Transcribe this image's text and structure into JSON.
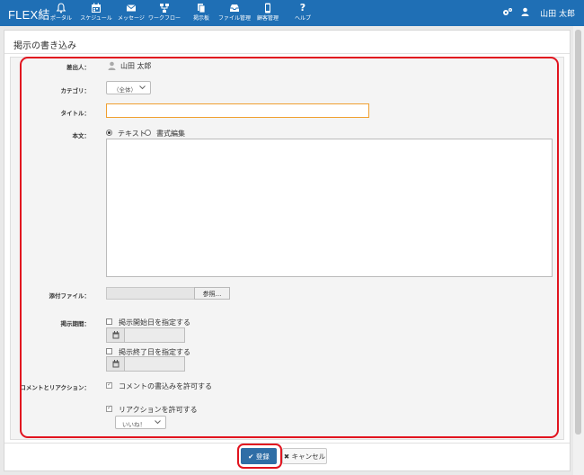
{
  "app": {
    "brand": "FLEX結"
  },
  "nav": [
    {
      "label": "ポータル",
      "icon": "bell-icon"
    },
    {
      "label": "スケジュール",
      "icon": "calendar-icon"
    },
    {
      "label": "メッセージ",
      "icon": "envelope-icon"
    },
    {
      "label": "ワークフロー",
      "icon": "workflow-icon"
    },
    {
      "label": "掲示板",
      "icon": "board-icon"
    },
    {
      "label": "ファイル管理",
      "icon": "inbox-icon"
    },
    {
      "label": "顧客管理",
      "icon": "phone-icon"
    },
    {
      "label": "ヘルプ",
      "icon": "question-icon"
    }
  ],
  "user": {
    "name": "山田 太郎"
  },
  "page": {
    "title": "掲示の書き込み"
  },
  "form": {
    "sender_label": "差出人：",
    "sender_value": "山田 太郎",
    "category_label": "カテゴリ：",
    "category_value": "（全体）",
    "title_label": "タイトル：",
    "title_value": "",
    "body_label": "本文：",
    "body_mode_text": "テキスト",
    "body_mode_rich": "書式編集",
    "body_value": "",
    "attach_label": "添付ファイル：",
    "browse_label": "参照...",
    "period_label": "掲示期間：",
    "start_check": "掲示開始日を指定する",
    "end_check": "掲示終了日を指定する",
    "comment_label": "コメントとリアクション：",
    "allow_comment": "コメントの書込みを許可する",
    "allow_reaction": "リアクションを許可する",
    "reaction_value": "いいね！"
  },
  "actions": {
    "submit": "登録",
    "cancel": "キャンセル"
  },
  "colors": {
    "nav_bg": "#1f6fb5",
    "accent_red": "#e1141f",
    "primary_button": "#2f6ea6",
    "title_focus": "#f0a030"
  }
}
